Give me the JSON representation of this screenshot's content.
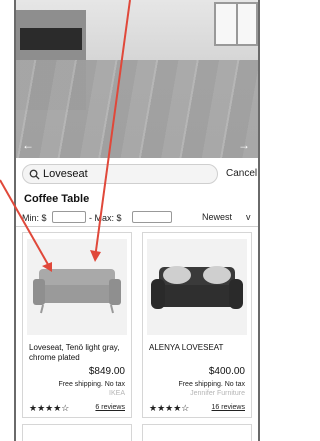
{
  "search": {
    "query": "Loveseat",
    "cancel_label": "Cancel"
  },
  "results": {
    "category": "Coffee Table",
    "min_label": "Min: $",
    "max_label": "- Max: $",
    "sort_value": "Newest",
    "sort_chevron": "v"
  },
  "carousel": {
    "prev_label": "←",
    "next_label": "→"
  },
  "products": [
    {
      "title": "Loveseat, Tenö light gray, chrome plated",
      "price": "$849.00",
      "shipping": "Free shipping. No tax",
      "vendor": "IKEA",
      "rating": 4,
      "stars_text": "★★★★☆",
      "reviews": "6 reviews"
    },
    {
      "title": "ALENYA LOVESEAT",
      "price": "$400.00",
      "shipping": "Free shipping. No tax",
      "vendor": "Jennifer Furniture",
      "rating": 4,
      "stars_text": "★★★★☆",
      "reviews": "16 reviews"
    }
  ],
  "colors": {
    "annotation_arrow": "#e0483a",
    "vendor_text": "#b5b5b5"
  }
}
